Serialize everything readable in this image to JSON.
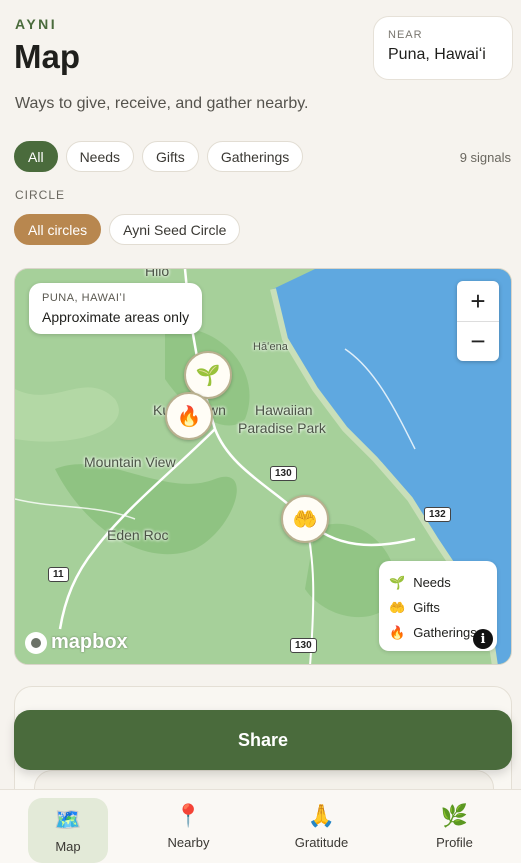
{
  "header": {
    "brand": "AYNI",
    "title": "Map",
    "subtitle": "Ways to give, receive, and gather nearby."
  },
  "near": {
    "label": "NEAR",
    "value": "Puna, Hawaiʻi"
  },
  "filters": {
    "types": [
      "All",
      "Needs",
      "Gifts",
      "Gatherings"
    ],
    "selected_type": "All",
    "signal_count": "9 signals",
    "circle_label": "CIRCLE",
    "circles": [
      "All circles",
      "Ayni Seed Circle"
    ],
    "selected_circle": "All circles"
  },
  "map": {
    "area_title": "PUNA, HAWAIʻI",
    "area_note": "Approximate areas only",
    "zoom_in": "+",
    "zoom_out": "−",
    "places": {
      "hilo": "Hilo",
      "haena": "Hāʻena",
      "kurtistown": "Ku",
      "kurtistown2": "wn",
      "hawaiian": "Hawaiian",
      "paradise": "Paradise Park",
      "mountain_view": "Mountain View",
      "eden_roc": "Eden Roc"
    },
    "roads": {
      "r130a": "130",
      "r130b": "130",
      "r132": "132",
      "r11": "11"
    },
    "pins": {
      "needs": "🌱",
      "gathering": "🔥",
      "gifts": "🤲"
    },
    "legend": [
      {
        "icon": "🌱",
        "label": "Needs"
      },
      {
        "icon": "🤲",
        "label": "Gifts"
      },
      {
        "icon": "🔥",
        "label": "Gatherings"
      }
    ],
    "attribution": "mapbox",
    "info": "i",
    "colors": {
      "land": "#a6d09a",
      "ocean": "#5fa8e0",
      "forest": "#86be78"
    }
  },
  "actions": {
    "share": "Share"
  },
  "nav": [
    {
      "icon": "🗺️",
      "label": "Map"
    },
    {
      "icon": "📍",
      "label": "Nearby"
    },
    {
      "icon": "🙏",
      "label": "Gratitude"
    },
    {
      "icon": "🌿",
      "label": "Profile"
    }
  ],
  "colors": {
    "accent": "#4a6b3c",
    "circle_accent": "#b8874f",
    "background": "#f6f3ee"
  }
}
